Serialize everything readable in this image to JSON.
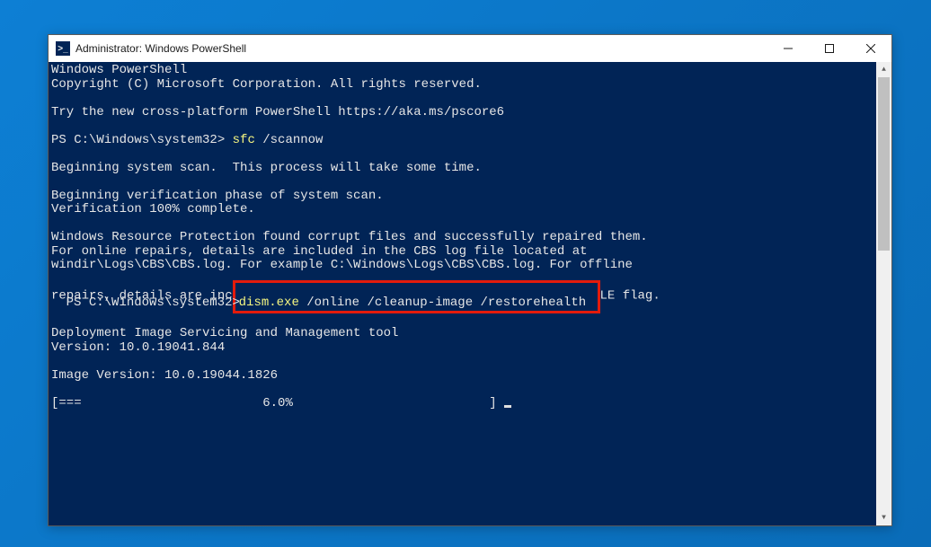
{
  "window": {
    "title": "Administrator: Windows PowerShell",
    "icon_label": ">_"
  },
  "terminal": {
    "header1": "Windows PowerShell",
    "header2": "Copyright (C) Microsoft Corporation. All rights reserved.",
    "try_line": "Try the new cross-platform PowerShell https://aka.ms/pscore6",
    "prompt1_prefix": "PS C:\\Windows\\system32> ",
    "prompt1_cmd_yellow": "sfc ",
    "prompt1_cmd_rest": "/scannow",
    "scan_begin": "Beginning system scan.  This process will take some time.",
    "verify_begin": "Beginning verification phase of system scan.",
    "verify_done": "Verification 100% complete.",
    "wrp_line1": "Windows Resource Protection found corrupt files and successfully repaired them.",
    "wrp_line2": "For online repairs, details are included in the CBS log file located at",
    "wrp_line3": "windir\\Logs\\CBS\\CBS.log. For example C:\\Windows\\Logs\\CBS\\CBS.log. For offline",
    "wrp_line4_before": "repairs, details are inc",
    "wrp_line4_after": "LE flag.",
    "prompt2_prefix": "PS C:\\Windows\\system32> ",
    "highlighted_cmd_yellow": "dism.exe ",
    "highlighted_cmd_rest": "/online /cleanup-image /restorehealth",
    "dism_header": "Deployment Image Servicing and Management tool",
    "dism_version": "Version: 10.0.19041.844",
    "image_version": "Image Version: 10.0.19044.1826",
    "progress_line": "[===                        6.0%                          ] "
  }
}
